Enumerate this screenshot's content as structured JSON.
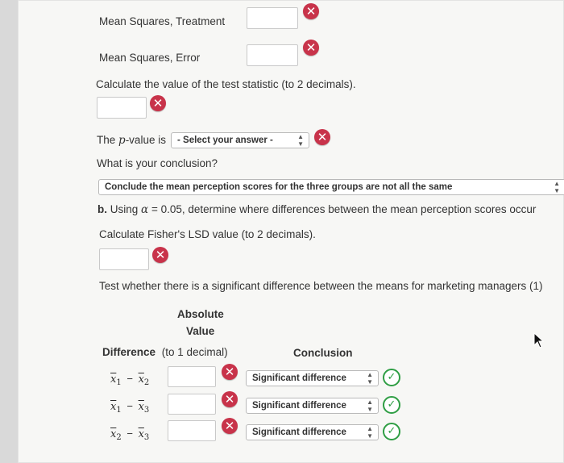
{
  "rows": {
    "ms_treatment_label": "Mean Squares, Treatment",
    "ms_error_label": "Mean Squares, Error"
  },
  "test_statistic": {
    "prompt": "Calculate the value of the test statistic (to 2 decimals)."
  },
  "p_value": {
    "label_prefix": "The",
    "label_var": "p",
    "label_suffix": "-value is",
    "select_value": "- Select your answer -"
  },
  "conclusion": {
    "question": "What is your conclusion?",
    "select_value": "Conclude the mean perception scores for the three groups are not all the same"
  },
  "part_b": {
    "label": "b.",
    "text_prefix": "Using",
    "alpha": "α",
    "equals": "= 0.05",
    "text_suffix": ", determine where differences between the mean perception scores occur",
    "lsd_prompt": "Calculate Fisher's LSD value (to 2 decimals).",
    "test_prompt": "Test whether there is a significant difference between the means for marketing managers (1)"
  },
  "table": {
    "header_absolute": "Absolute",
    "header_value": "Value",
    "header_difference": "Difference",
    "header_decimal": "(to 1 decimal)",
    "header_conclusion": "Conclusion",
    "rows": [
      {
        "a": "x",
        "a_sub": "1",
        "b": "x",
        "b_sub": "2",
        "select_value": "Significant difference"
      },
      {
        "a": "x",
        "a_sub": "1",
        "b": "x",
        "b_sub": "3",
        "select_value": "Significant difference"
      },
      {
        "a": "x",
        "a_sub": "2",
        "b": "x",
        "b_sub": "3",
        "select_value": "Significant difference"
      }
    ]
  },
  "icons": {
    "error": "error-x-icon",
    "correct": "check-circle-icon",
    "cursor": "mouse-pointer-icon"
  },
  "colors": {
    "error_red": "#c8334a",
    "correct_green": "#2f9e44"
  }
}
